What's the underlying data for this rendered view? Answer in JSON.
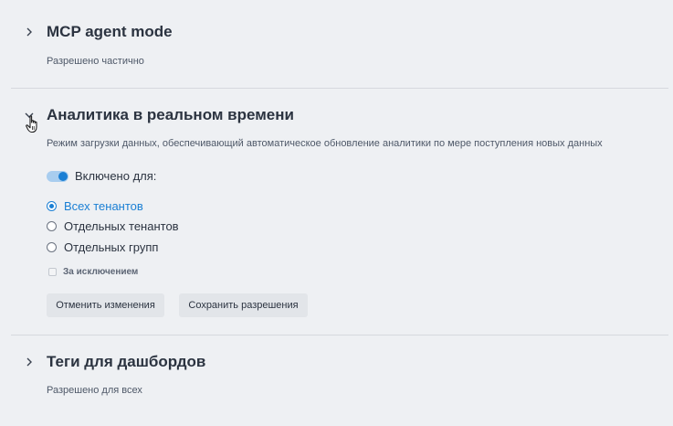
{
  "sections": [
    {
      "title": "MCP agent mode",
      "subtitle": "Разрешено частично",
      "expanded": false
    },
    {
      "title": "Аналитика в реальном времени",
      "subtitle": "Режим загрузки данных, обеспечивающий автоматическое обновление аналитики по мере поступления новых данных",
      "expanded": true,
      "toggle": {
        "on": true,
        "label": "Включено для:"
      },
      "radio_options": [
        {
          "label": "Всех тенантов",
          "checked": true
        },
        {
          "label": "Отдельных тенантов",
          "checked": false
        },
        {
          "label": "Отдельных групп",
          "checked": false
        }
      ],
      "exclusion_checkbox": {
        "label": "За исключением",
        "checked": false,
        "disabled": true
      },
      "buttons": {
        "cancel": "Отменить изменения",
        "save": "Сохранить разрешения"
      }
    },
    {
      "title": "Теги для дашбордов",
      "subtitle": "Разрешено для всех",
      "expanded": false
    }
  ],
  "colors": {
    "accent": "#1a7fd4",
    "background": "#eef0f3",
    "text": "#2b3340"
  },
  "icons": {
    "collapsed": "chevron-right-icon",
    "expanded": "chevron-down-icon",
    "cursor": "hand-pointer-cursor"
  }
}
